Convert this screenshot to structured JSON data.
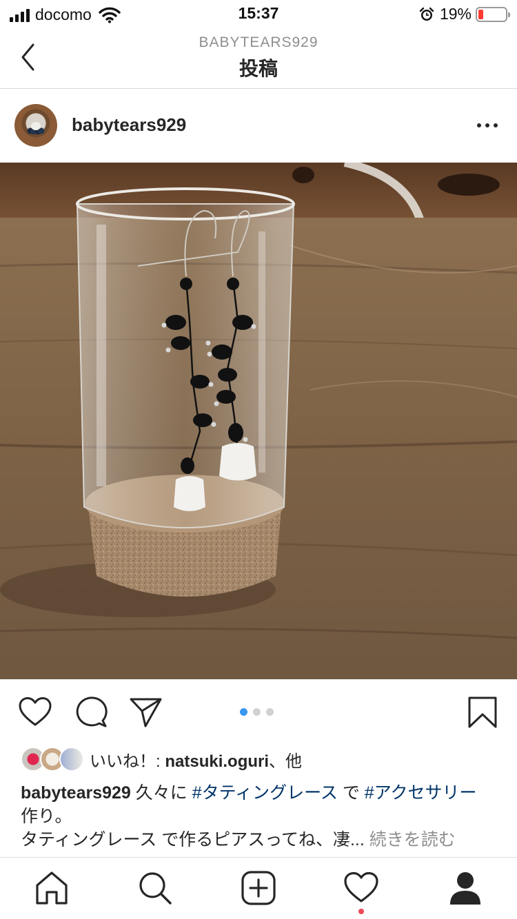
{
  "status_bar": {
    "carrier": "docomo",
    "time": "15:37",
    "battery_percent": "19%",
    "battery_level": 0.19,
    "battery_color": "#ff3b30"
  },
  "header": {
    "subtitle": "BABYTEARS929",
    "title": "投稿"
  },
  "post": {
    "username": "babytears929",
    "carousel": {
      "count": 3,
      "active_index": 0,
      "active_color": "#3897f0"
    }
  },
  "likes": {
    "prefix": "いいね！: ",
    "user": "natsuki.oguri",
    "suffix": "、他"
  },
  "caption": {
    "username": "babytears929",
    "text1": " 久々に ",
    "hashtag1": "#タティングレース",
    "text2": " で ",
    "hashtag2": "#アクセサリー",
    "text3": " 作り。",
    "line2": "タティングレース で作るピアスってね、凄...",
    "more": " 続きを読む",
    "hashtag_color": "#003569"
  },
  "icons": {
    "back": "chevron-left-icon",
    "more": "more-horizontal-icon",
    "like": "heart-outline-icon",
    "comment": "comment-bubble-icon",
    "share": "paper-plane-icon",
    "save": "bookmark-icon",
    "home": "home-icon",
    "search": "search-icon",
    "new_post": "plus-square-icon",
    "activity": "heart-outline-icon",
    "profile": "profile-icon"
  }
}
